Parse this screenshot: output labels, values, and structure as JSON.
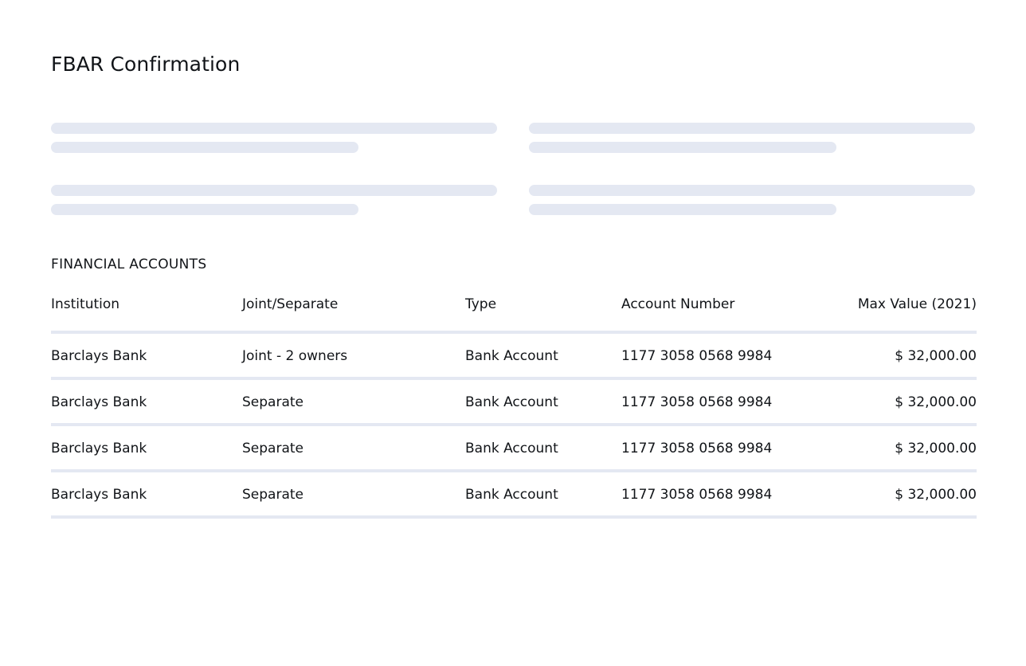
{
  "page": {
    "title": "FBAR Confirmation"
  },
  "financial_accounts": {
    "heading": "FINANCIAL ACCOUNTS",
    "columns": {
      "institution": "Institution",
      "joint_separate": "Joint/Separate",
      "type": "Type",
      "account_number": "Account Number",
      "max_value": "Max Value (2021)"
    },
    "rows": [
      {
        "institution": "Barclays Bank",
        "joint_separate": "Joint - 2 owners",
        "type": "Bank Account",
        "account_number": "1177 3058 0568 9984",
        "max_value": "$ 32,000.00"
      },
      {
        "institution": "Barclays Bank",
        "joint_separate": "Separate",
        "type": "Bank Account",
        "account_number": "1177 3058 0568 9984",
        "max_value": "$ 32,000.00"
      },
      {
        "institution": "Barclays Bank",
        "joint_separate": "Separate",
        "type": "Bank Account",
        "account_number": "1177 3058 0568 9984",
        "max_value": "$ 32,000.00"
      },
      {
        "institution": "Barclays Bank",
        "joint_separate": "Separate",
        "type": "Bank Account",
        "account_number": "1177 3058 0568 9984",
        "max_value": "$ 32,000.00"
      }
    ]
  },
  "colors": {
    "skeleton": "#e4e8f2",
    "divider": "#e4e8f2",
    "text": "#111418"
  }
}
